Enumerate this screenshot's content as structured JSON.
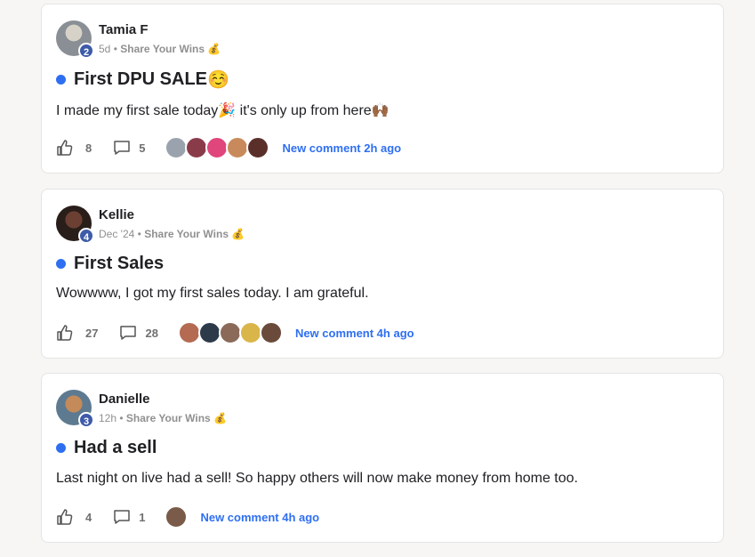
{
  "posts": [
    {
      "author": "Tamia F",
      "level": "2",
      "time": "5d",
      "category": "Share Your Wins",
      "category_emoji": "💰",
      "title": "First DPU SALE",
      "title_emoji": "☺️",
      "body": "I made my first sale today🎉 it's only up from here🙌🏾",
      "likes": "8",
      "comments": "5",
      "new_comment": "New comment 2h ago",
      "avatar_color": "#8a8f96",
      "faces": [
        "#9aa3ad",
        "#8a3b4a",
        "#e0457b",
        "#c98a5b",
        "#5a2f2a"
      ]
    },
    {
      "author": "Kellie ",
      "level": "4",
      "time": "Dec '24",
      "category": "Share Your Wins",
      "category_emoji": "💰",
      "title": "First Sales",
      "title_emoji": "",
      "body": "Wowwww, I got my first sales today. I am grateful.",
      "likes": "27",
      "comments": "28",
      "new_comment": "New comment 4h ago",
      "avatar_color": "#4a2f28",
      "faces": [
        "#b56a52",
        "#2d3a4a",
        "#8b6a5a",
        "#d9b54a",
        "#6a4a3a"
      ]
    },
    {
      "author": "Danielle",
      "level": "3",
      "time": "12h",
      "category": "Share Your Wins",
      "category_emoji": "💰",
      "title": "Had a sell",
      "title_emoji": "",
      "body": "Last night on live had a sell! So happy others will now make money from home too.",
      "likes": "4",
      "comments": "1",
      "new_comment": "New comment 4h ago",
      "avatar_color": "#a0642e",
      "faces": [
        "#7a5a48"
      ]
    }
  ],
  "icons": {
    "like": "thumbs-up-icon",
    "comment": "comment-bubble-icon"
  },
  "colors": {
    "accent": "#2e6ff2",
    "level_badge": "#3e5ba9",
    "background": "#f7f6f4"
  }
}
